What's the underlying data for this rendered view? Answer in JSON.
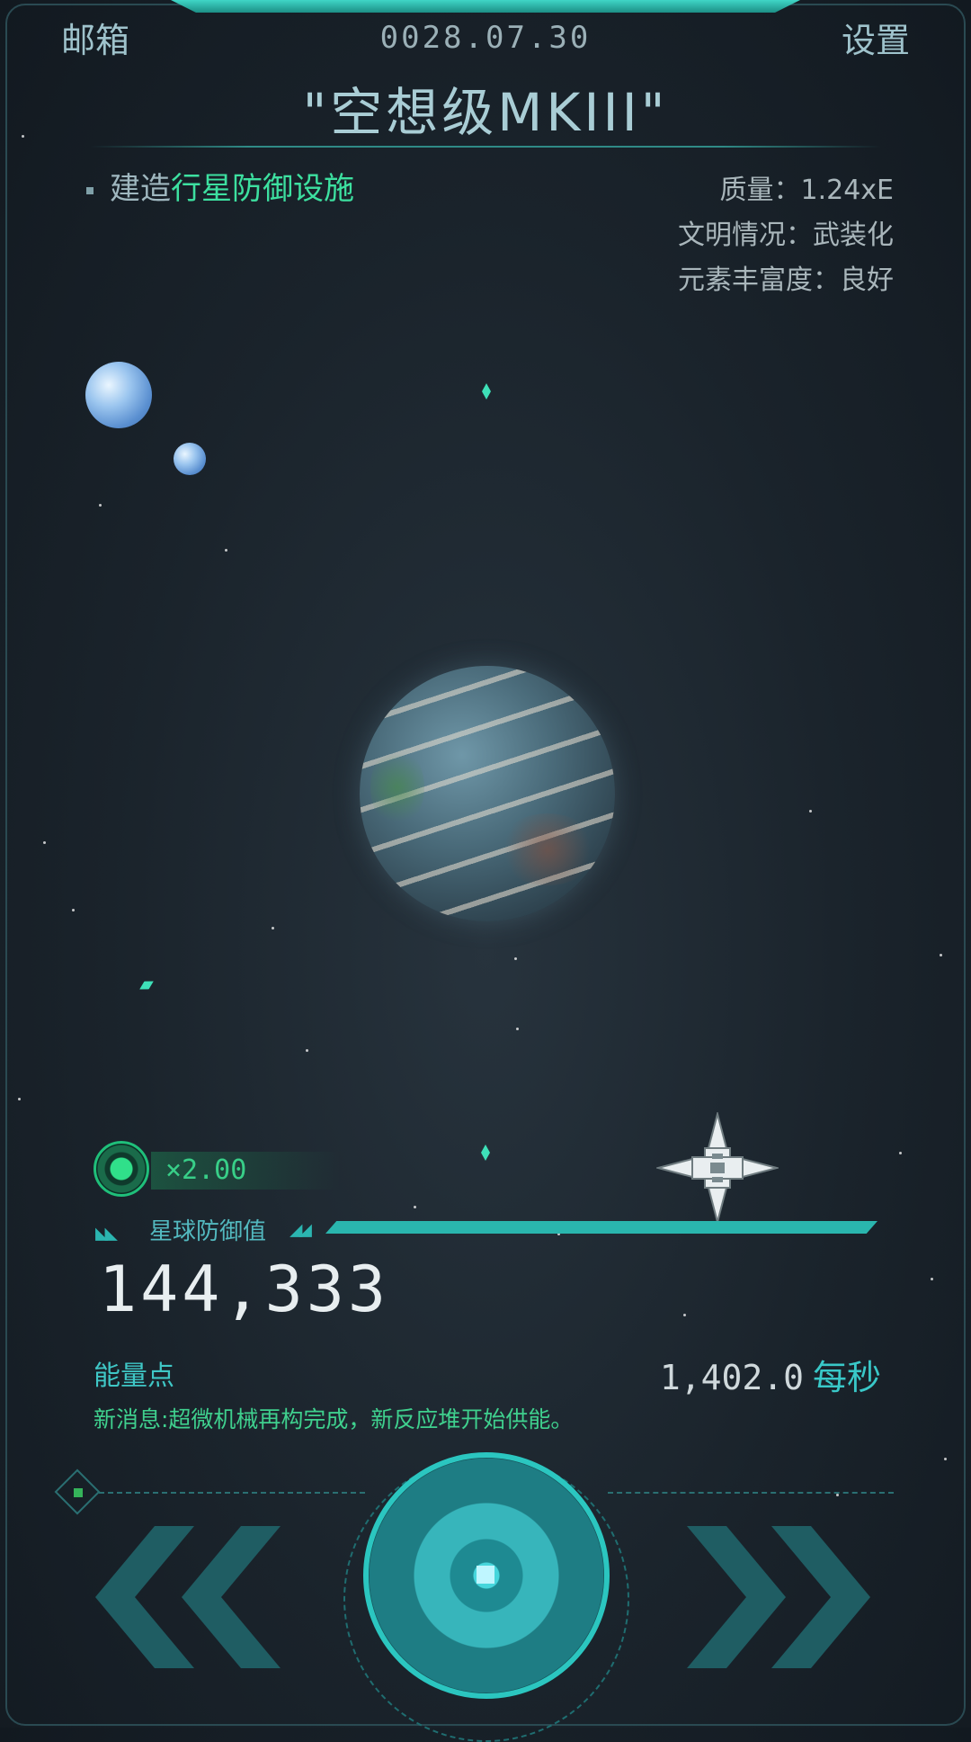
{
  "header": {
    "mail_label": "邮箱",
    "date": "0028.07.30",
    "settings_label": "设置",
    "ship_name": "\"空想级MKIII\""
  },
  "task": {
    "prefix": "建造",
    "highlight": "行星防御设施"
  },
  "planet_stats": {
    "mass": "质量：1.24xE",
    "civilization": "文明情况：武装化",
    "elements": "元素丰富度：良好"
  },
  "multiplier": "×2.00",
  "defense": {
    "label": "星球防御值",
    "value": "144,333"
  },
  "energy": {
    "label": "能量点",
    "rate": "1,402.0",
    "unit": "每秒"
  },
  "news": "新消息:超微机械再构完成，新反应堆开始供能。",
  "icons": {
    "multiplier": "target-radar-icon",
    "left": "double-chevron-left-icon",
    "right": "double-chevron-right-icon",
    "main": "power-core-button-icon",
    "ship": "spaceship-icon"
  },
  "colors": {
    "accent": "#2bc6c0",
    "highlight": "#3de0a0",
    "background": "#1a232b"
  }
}
